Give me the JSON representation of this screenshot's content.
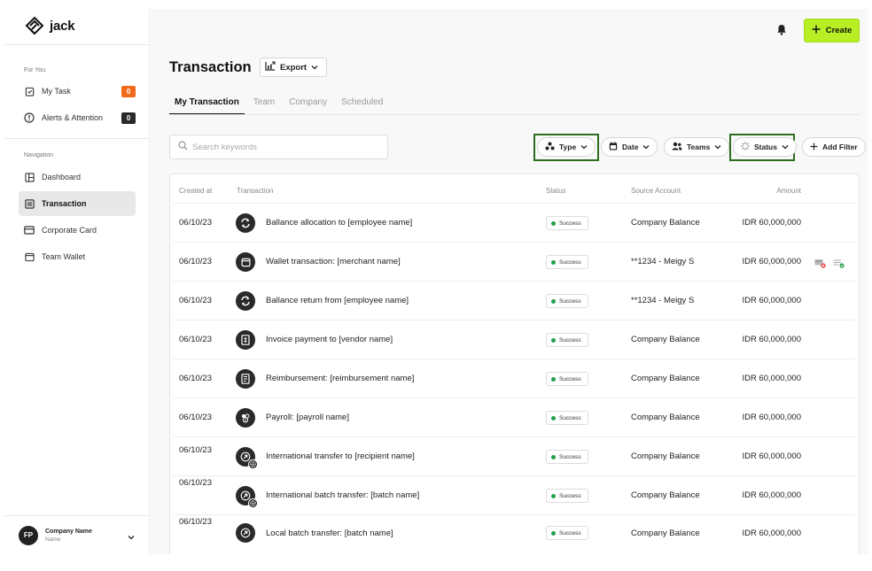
{
  "brand": {
    "name": "jack"
  },
  "sidebar": {
    "for_you_label": "For You",
    "for_you_items": [
      {
        "label": "My Task",
        "icon": "clipboard-check-icon",
        "badge": "0",
        "badge_color": "#f26a1b"
      },
      {
        "label": "Alerts & Attention",
        "icon": "alert-circle-icon",
        "badge": "0",
        "badge_color": "#2a2a2a"
      }
    ],
    "navigation_label": "Navigation",
    "nav_items": [
      {
        "label": "Dashboard",
        "icon": "layout-icon",
        "active": false
      },
      {
        "label": "Transaction",
        "icon": "list-icon",
        "active": true
      },
      {
        "label": "Corporate Card",
        "icon": "card-icon",
        "active": false
      },
      {
        "label": "Team Wallet",
        "icon": "wallet-icon",
        "active": false
      }
    ],
    "company": {
      "initials": "FP",
      "name": "Company Name",
      "role": "Name"
    }
  },
  "header": {
    "create_label": "Create",
    "accent_color": "#b7ef24"
  },
  "page": {
    "title": "Transaction",
    "export_label": "Export",
    "tabs": [
      {
        "label": "My Transaction",
        "active": true
      },
      {
        "label": "Team",
        "active": false
      },
      {
        "label": "Company",
        "active": false
      },
      {
        "label": "Scheduled",
        "active": false
      }
    ],
    "search_placeholder": "Search keywords",
    "filters": [
      {
        "label": "Type",
        "highlighted": true
      },
      {
        "label": "Date",
        "highlighted": false
      },
      {
        "label": "Teams",
        "highlighted": false
      },
      {
        "label": "Status",
        "highlighted": true
      }
    ],
    "add_filter_label": "Add Filter",
    "highlight_color": "#2c6e1e"
  },
  "table": {
    "columns": [
      "Created at",
      "Transaction",
      "Status",
      "Source Account",
      "Amount"
    ],
    "rows": [
      {
        "created_at": "06/10/23",
        "icon": "refresh-icon",
        "transaction": "Ballance allocation to [employee name]",
        "status": "Success",
        "source": "Company Balance",
        "amount": "IDR 60,000,000"
      },
      {
        "created_at": "06/10/23",
        "icon": "wallet-icon",
        "transaction": "Wallet transaction: [merchant name]",
        "status": "Success",
        "source": "**1234 - Meigy S",
        "amount": "IDR 60,000,000",
        "actions": true
      },
      {
        "created_at": "06/10/23",
        "icon": "refresh-icon",
        "transaction": "Ballance return from [employee name]",
        "status": "Success",
        "source": "**1234 - Meigy S",
        "amount": "IDR 60,000,000"
      },
      {
        "created_at": "06/10/23",
        "icon": "invoice-icon",
        "transaction": "Invoice payment to [vendor name]",
        "status": "Success",
        "source": "Company Balance",
        "amount": "IDR 60,000,000"
      },
      {
        "created_at": "06/10/23",
        "icon": "receipt-icon",
        "transaction": "Reimbursement: [reimbursement name]",
        "status": "Success",
        "source": "Company Balance",
        "amount": "IDR 60,000,000"
      },
      {
        "created_at": "06/10/23",
        "icon": "payroll-icon",
        "transaction": "Payroll: [payroll name]",
        "status": "Success",
        "source": "Company Balance",
        "amount": "IDR 60,000,000"
      },
      {
        "created_at": "06/10/23",
        "icon": "transfer-arrow-icon",
        "globe": true,
        "transaction": "International transfer to [recipient name]",
        "status": "Success",
        "source": "Company Balance",
        "amount": "IDR 60,000,000"
      },
      {
        "created_at": "06/10/23",
        "icon": "transfer-arrow-icon",
        "globe": true,
        "transaction": "International batch transfer: [batch name]",
        "status": "Success",
        "source": "Company Balance",
        "amount": "IDR 60,000,000"
      },
      {
        "created_at": "06/10/23",
        "icon": "transfer-arrow-icon",
        "transaction": "Local batch transfer: [batch name]",
        "status": "Success",
        "source": "Company Balance",
        "amount": "IDR 60,000,000"
      }
    ]
  }
}
